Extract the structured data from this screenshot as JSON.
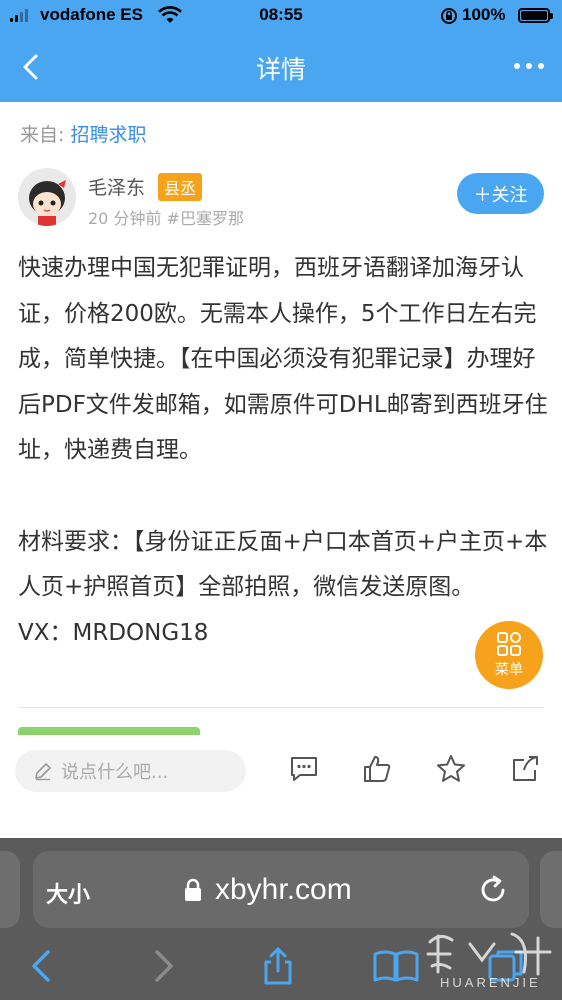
{
  "status_bar": {
    "carrier": "vodafone ES",
    "time": "08:55",
    "battery": "100%"
  },
  "nav": {
    "title": "详情"
  },
  "source": {
    "prefix": "来自: ",
    "category": "招聘求职"
  },
  "author": {
    "name": "毛泽东",
    "badge": "县丞",
    "meta": "20 分钟前 #巴塞罗那",
    "follow_label": "＋关注"
  },
  "content": {
    "paragraph1": "快速办理中国无犯罪证明，西班牙语翻译加海牙认证，价格200欧。无需本人操作，5个工作日左右完成，简单快捷。【在中国必须没有犯罪记录】办理好后PDF文件发邮箱，如需原件可DHL邮寄到西班牙住址，快递费自理。",
    "paragraph2": "材料要求：【身份证正反面+户口本首页+户主页+本人页+护照首页】全部拍照，微信发送原图。",
    "paragraph3": "VX：MRDONG18"
  },
  "menu_fab": {
    "label": "菜单"
  },
  "comment": {
    "placeholder": "说点什么吧..."
  },
  "browser": {
    "text_size_label": "大小",
    "url": "xbyhr.com"
  },
  "watermark": {
    "text": "HUARENJIE"
  },
  "colors": {
    "brand_blue": "#4aa6f0",
    "badge_orange": "#f7a21b",
    "link_blue": "#3a8ee6"
  }
}
